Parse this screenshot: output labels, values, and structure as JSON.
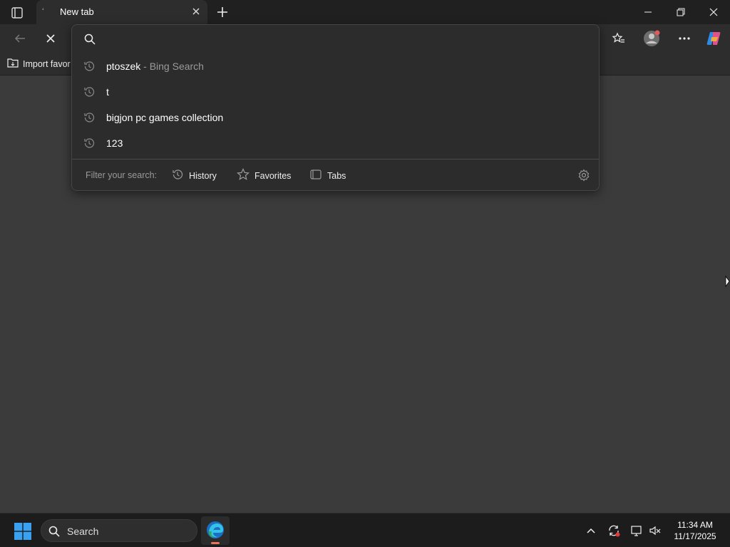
{
  "tab": {
    "title": "New tab"
  },
  "favorites_bar": {
    "import_label": "Import favor"
  },
  "omnibox": {
    "input_value": "",
    "suggestions": [
      {
        "text": "ptoszek",
        "sub": " - Bing Search"
      },
      {
        "text": "t",
        "sub": ""
      },
      {
        "text": "bigjon pc games collection",
        "sub": ""
      },
      {
        "text": "123",
        "sub": ""
      }
    ],
    "filter": {
      "label": "Filter your search:",
      "history": "History",
      "favorites": "Favorites",
      "tabs": "Tabs"
    }
  },
  "taskbar": {
    "search_placeholder": "Search",
    "time": "11:34 AM",
    "date": "11/17/2025"
  },
  "colors": {
    "accent_edge": "#1f8ae0",
    "indicator": "#e8745a"
  }
}
